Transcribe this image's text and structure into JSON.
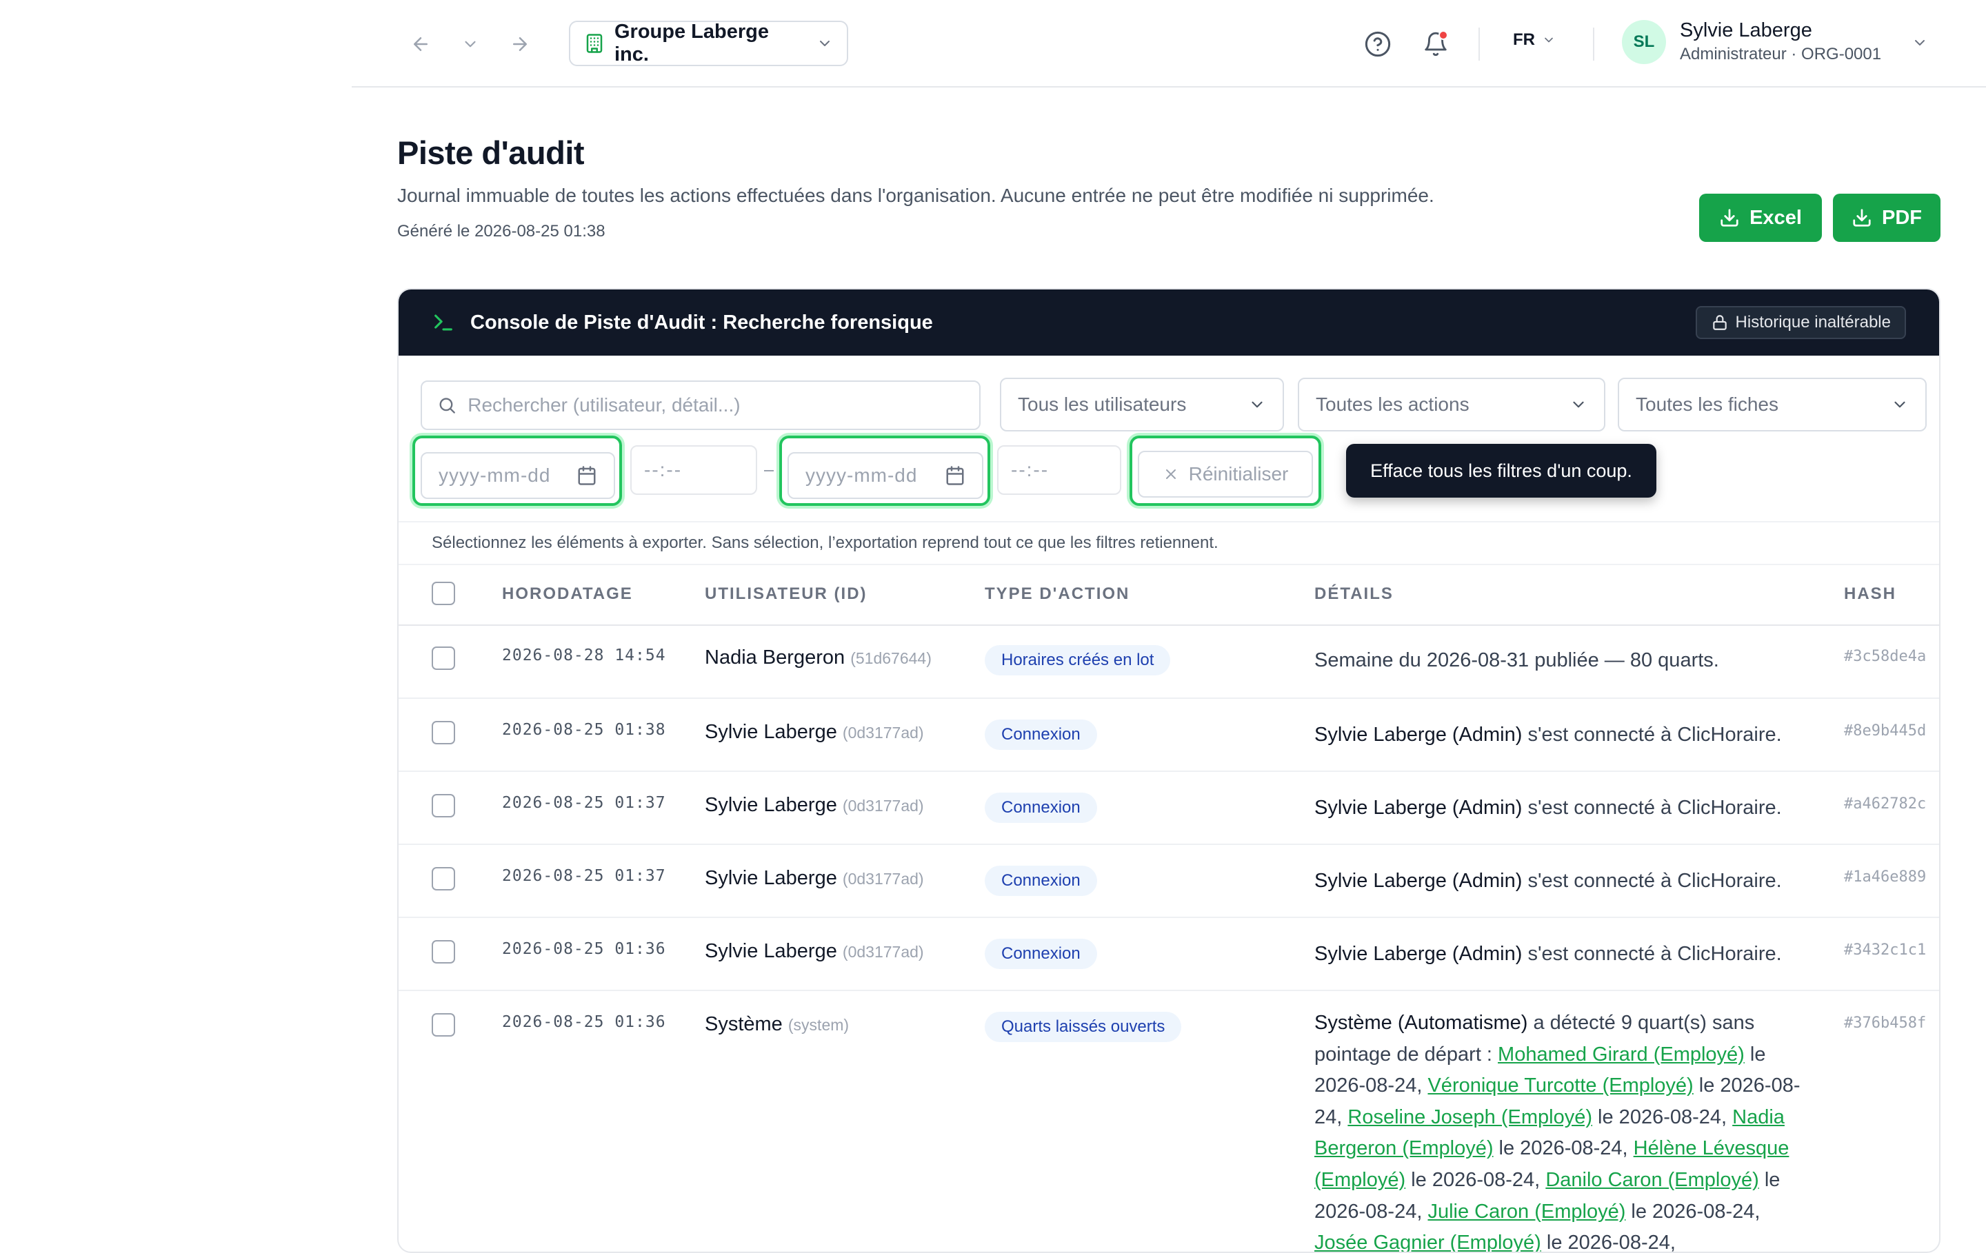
{
  "topbar": {
    "org_name": "Groupe Laberge inc.",
    "lang": "FR",
    "user": {
      "initials": "SL",
      "name": "Sylvie Laberge",
      "role": "Administrateur · ORG-0001"
    }
  },
  "page": {
    "title": "Piste d'audit",
    "subtitle": "Journal immuable de toutes les actions effectuées dans l'organisation. Aucune entrée ne peut être modifiée ni supprimée.",
    "generated": "Généré le 2026-08-25 01:38",
    "export_excel": "Excel",
    "export_pdf": "PDF"
  },
  "console": {
    "title": "Console de Piste d'Audit : Recherche forensique",
    "immutable_badge": "Historique inaltérable",
    "search_placeholder": "Rechercher (utilisateur, détail...)",
    "filter_users": "Tous les utilisateurs",
    "filter_actions": "Toutes les actions",
    "filter_sheets": "Toutes les fiches",
    "date_from_placeholder": "yyyy-mm-dd",
    "time_from_placeholder": "--:--",
    "date_to_placeholder": "yyyy-mm-dd",
    "time_to_placeholder": "--:--",
    "reset_label": "Réinitialiser",
    "reset_tooltip": "Efface tous les filtres d'un coup.",
    "selection_hint": "Sélectionnez les éléments à exporter. Sans sélection, l’exportation reprend tout ce que les filtres retiennent."
  },
  "table": {
    "headers": {
      "timestamp": "HORODATAGE",
      "user": "UTILISATEUR (ID)",
      "action_type": "TYPE D'ACTION",
      "details": "DÉTAILS",
      "hash": "HASH"
    },
    "rows": [
      {
        "timestamp": "2026-08-28 14:54",
        "user": "Nadia Bergeron",
        "user_id": "(51d67644)",
        "action": "Horaires créés en lot",
        "detail_actor": "",
        "detail_text": "Semaine du 2026-08-31 publiée — 80 quarts.",
        "hash": "#3c58de4a"
      },
      {
        "timestamp": "2026-08-25 01:38",
        "user": "Sylvie Laberge",
        "user_id": "(0d3177ad)",
        "action": "Connexion",
        "detail_actor": "Sylvie Laberge (Admin)",
        "detail_text": " s'est connecté à ClicHoraire.",
        "hash": "#8e9b445d"
      },
      {
        "timestamp": "2026-08-25 01:37",
        "user": "Sylvie Laberge",
        "user_id": "(0d3177ad)",
        "action": "Connexion",
        "detail_actor": "Sylvie Laberge (Admin)",
        "detail_text": " s'est connecté à ClicHoraire.",
        "hash": "#a462782c"
      },
      {
        "timestamp": "2026-08-25 01:37",
        "user": "Sylvie Laberge",
        "user_id": "(0d3177ad)",
        "action": "Connexion",
        "detail_actor": "Sylvie Laberge (Admin)",
        "detail_text": " s'est connecté à ClicHoraire.",
        "hash": "#1a46e889"
      },
      {
        "timestamp": "2026-08-25 01:36",
        "user": "Sylvie Laberge",
        "user_id": "(0d3177ad)",
        "action": "Connexion",
        "detail_actor": "Sylvie Laberge (Admin)",
        "detail_text": " s'est connecté à ClicHoraire.",
        "hash": "#3432c1c1"
      },
      {
        "timestamp": "2026-08-25 01:36",
        "user": "Système",
        "user_id": "(system)",
        "action": "Quarts laissés ouverts",
        "detail_actor": "Système (Automatisme)",
        "detail_text": " a détecté 9 quart(s) sans pointage de départ : ",
        "detail_links": [
          {
            "name": "Mohamed Girard (Employé)",
            "suffix": " le 2026-08-24, "
          },
          {
            "name": "Véronique Turcotte (Employé)",
            "suffix": " le 2026-08-24, "
          },
          {
            "name": "Roseline Joseph (Employé)",
            "suffix": " le 2026-08-24, "
          },
          {
            "name": "Nadia Bergeron (Employé)",
            "suffix": " le 2026-08-24, "
          },
          {
            "name": "Hélène Lévesque (Employé)",
            "suffix": " le 2026-08-24, "
          },
          {
            "name": "Danilo Caron (Employé)",
            "suffix": " le 2026-08-24, "
          },
          {
            "name": "Julie Caron (Employé)",
            "suffix": " le 2026-08-24, "
          },
          {
            "name": "Josée Gagnier (Employé)",
            "suffix": " le 2026-08-24, "
          }
        ],
        "hash": "#376b458f"
      }
    ]
  },
  "colors": {
    "accent": "#16a34a",
    "console_header": "#111827",
    "focus_ring": "#22c55e",
    "badge_bg": "#eef5fd",
    "badge_text": "#1e40af",
    "notification_dot": "#ef4444"
  },
  "icons": {
    "back": "arrow-left-icon",
    "history": "chevron-down-icon",
    "forward": "arrow-right-icon",
    "org": "building-icon",
    "help": "help-circle-icon",
    "notifications": "bell-icon",
    "terminal": "terminal-icon",
    "lock": "lock-icon",
    "search": "search-icon",
    "calendar": "calendar-icon",
    "reset": "close-icon",
    "download": "download-icon"
  }
}
